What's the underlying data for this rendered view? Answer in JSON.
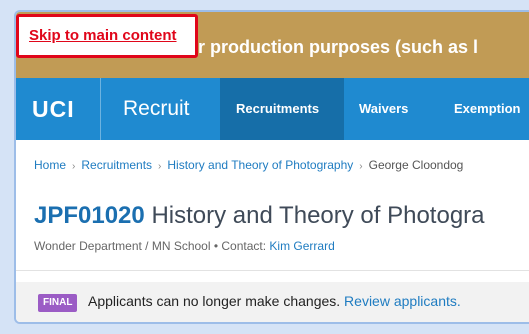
{
  "warning_banner": {
    "text": "t use for production purposes (such as l"
  },
  "skip_link": {
    "label": "Skip to main content"
  },
  "navbar": {
    "logo": "UCI",
    "app_name": "Recruit",
    "tabs": [
      {
        "label": "Recruitments",
        "active": true
      },
      {
        "label": "Waivers",
        "active": false
      },
      {
        "label": "Exemption",
        "active": false
      }
    ]
  },
  "breadcrumb": {
    "items": [
      "Home",
      "Recruitments",
      "History and Theory of Photography"
    ],
    "current": "George Cloondog"
  },
  "page": {
    "code": "JPF01020",
    "title": "History and Theory of Photogra",
    "meta_prefix": "Wonder Department / MN School • Contact: ",
    "contact": "Kim Gerrard"
  },
  "status": {
    "badge": "FINAL",
    "text": "Applicants can no longer make changes. ",
    "link": "Review applicants."
  }
}
